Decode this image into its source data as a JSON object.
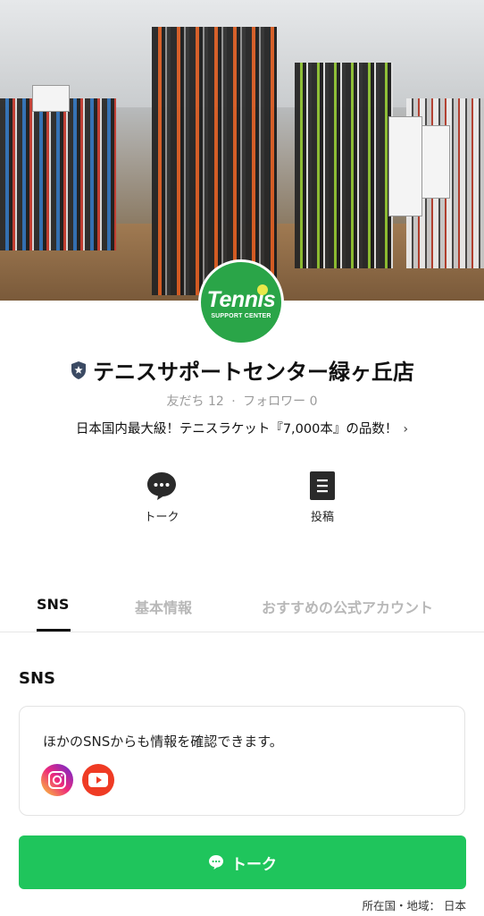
{
  "account": {
    "name": "テニスサポートセンター緑ヶ丘店",
    "logo_word": "Tennis",
    "logo_sub": "SUPPORT CENTER",
    "friends": "友だち 12",
    "separator": "·",
    "followers": "フォロワー 0",
    "description": "日本国内最大級！テニスラケット『7,000本』の品数！",
    "description_chevron": "›"
  },
  "actions": {
    "talk_label": "トーク",
    "post_label": "投稿"
  },
  "tabs": [
    {
      "label": "SNS",
      "active": true
    },
    {
      "label": "基本情報",
      "active": false
    },
    {
      "label": "おすすめの公式アカウント",
      "active": false
    }
  ],
  "sns_section": {
    "title": "SNS",
    "card_text": "ほかのSNSからも情報を確認できます。",
    "icons": [
      "instagram-icon",
      "youtube-icon"
    ]
  },
  "talk_button": {
    "label": "トーク"
  },
  "footer": {
    "location": "所在国・地域： 日本"
  },
  "colors": {
    "brand_green": "#1fc55c",
    "logo_green": "#2aa548",
    "youtube_red": "#ef3b24"
  }
}
